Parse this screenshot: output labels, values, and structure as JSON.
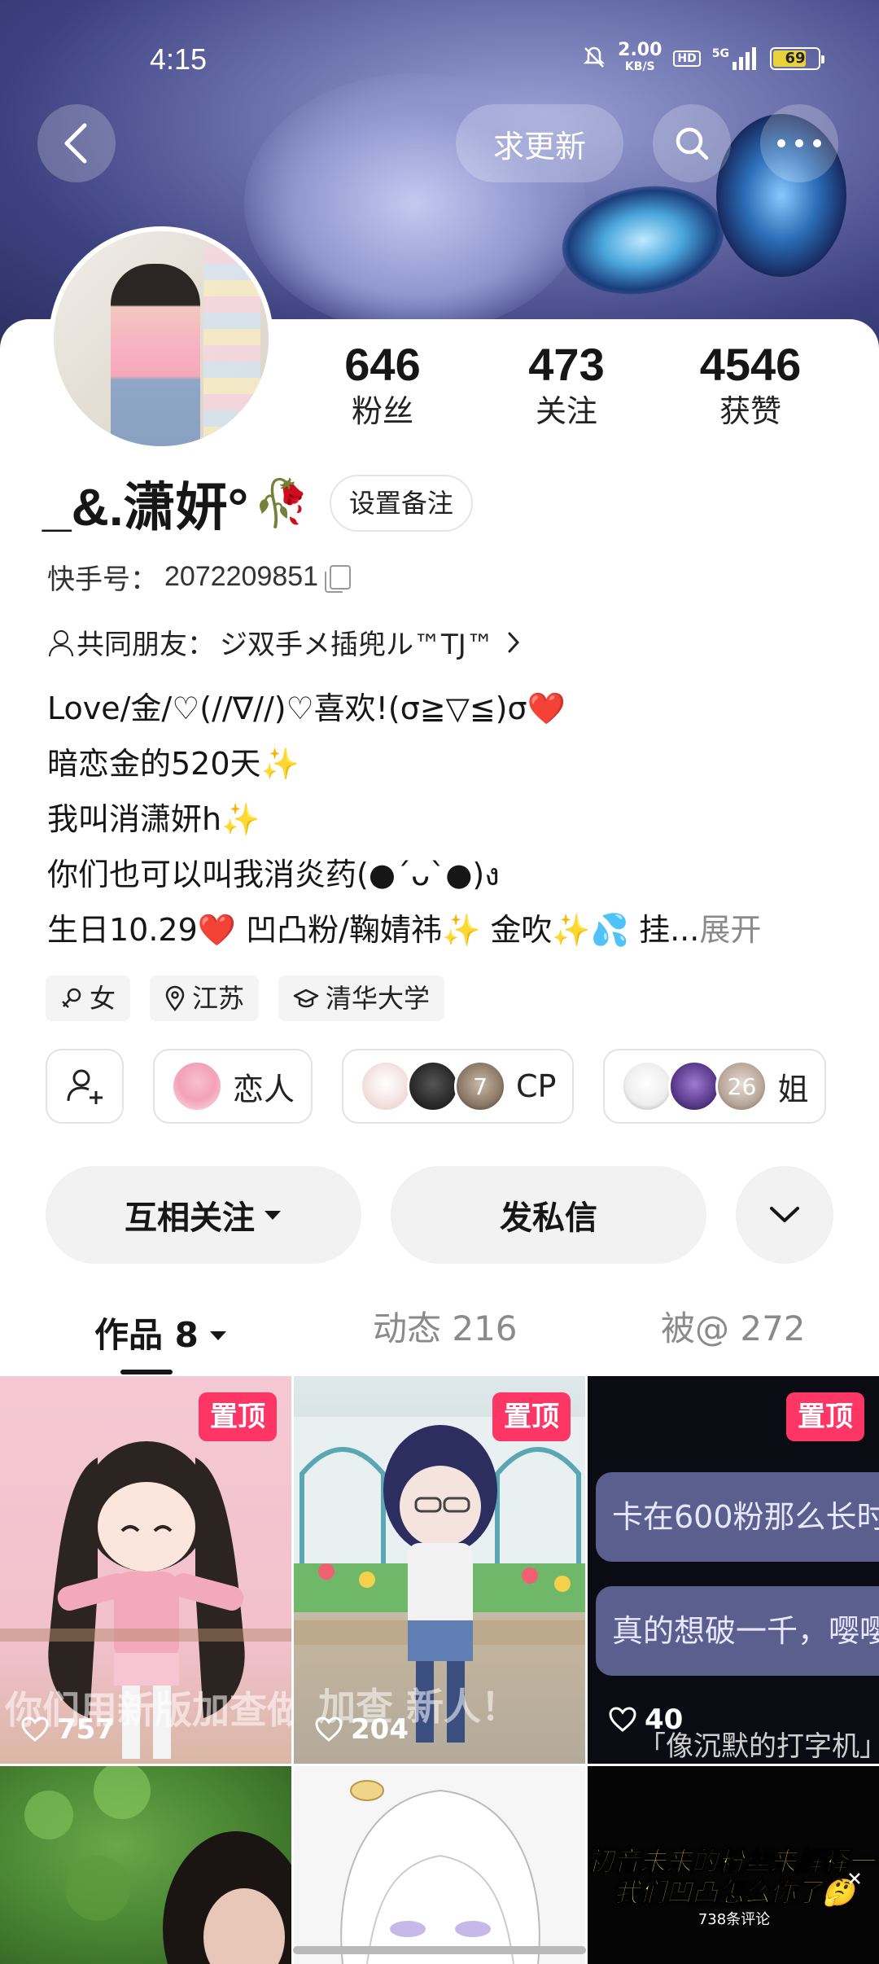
{
  "status_bar": {
    "time": "4:15",
    "net_speed_value": "2.00",
    "net_speed_unit": "KB/S",
    "hd": "HD",
    "network": "5G",
    "battery": "69"
  },
  "top_nav": {
    "request_update_label": "求更新"
  },
  "stats": [
    {
      "value": "646",
      "label": "粉丝"
    },
    {
      "value": "473",
      "label": "关注"
    },
    {
      "value": "4546",
      "label": "获赞"
    }
  ],
  "profile": {
    "name": "_&.潇妍°",
    "name_emoji": "🥀",
    "set_note_label": "设置备注",
    "kwai_id_label": "快手号：",
    "kwai_id": "2072209851",
    "mutual_label": "共同朋友：",
    "mutual_friend": "ジ双手メ插兜ル™TJ™",
    "bio_lines": [
      "Love/金/♡(//∇//)♡喜欢!(σ≧▽≦)σ❤️",
      "暗恋金的520天✨",
      "我叫消潇妍h✨",
      "你们也可以叫我消炎药(●´ᴗ`●)ง",
      "生日10.29❤️ 凹凸粉/鞠婧祎✨ 金吹✨💦 挂..."
    ],
    "expand_label": "展开"
  },
  "tags": [
    {
      "icon": "female-icon",
      "label": "女"
    },
    {
      "icon": "location-icon",
      "label": "江苏"
    },
    {
      "icon": "graduation-cap-icon",
      "label": "清华大学"
    }
  ],
  "relations": [
    {
      "label": "恋人"
    },
    {
      "label": "CP",
      "badge": "7"
    },
    {
      "label": "姐",
      "badge": "26"
    }
  ],
  "actions": {
    "follow_label": "互相关注",
    "message_label": "发私信"
  },
  "tabs": [
    {
      "label": "作品 8",
      "active": true
    },
    {
      "label": "动态 216",
      "active": false
    },
    {
      "label": "被@ 272",
      "active": false
    }
  ],
  "grid": [
    {
      "pinned": true,
      "pin_label": "置顶",
      "likes": "757",
      "overlay": "你们用新版加查做"
    },
    {
      "pinned": true,
      "pin_label": "置顶",
      "likes": "204",
      "overlay": "加查 新人！"
    },
    {
      "pinned": true,
      "pin_label": "置顶",
      "likes": "40",
      "bubble1": "卡在600粉那么长时",
      "bubble2": "真的想破一千，嘤嘤",
      "footer": "「像沉默的打字机」"
    },
    {
      "pinned": false
    },
    {
      "pinned": false
    },
    {
      "pinned": false,
      "line1": "初音未来的粉丝来解释一下",
      "line2": "我们凹凸怎么你了🤔",
      "comments": "738条评论"
    }
  ],
  "colors": {
    "accent_pin": "#fe3666",
    "text_primary": "#161616",
    "text_secondary": "#8a8a8a"
  }
}
